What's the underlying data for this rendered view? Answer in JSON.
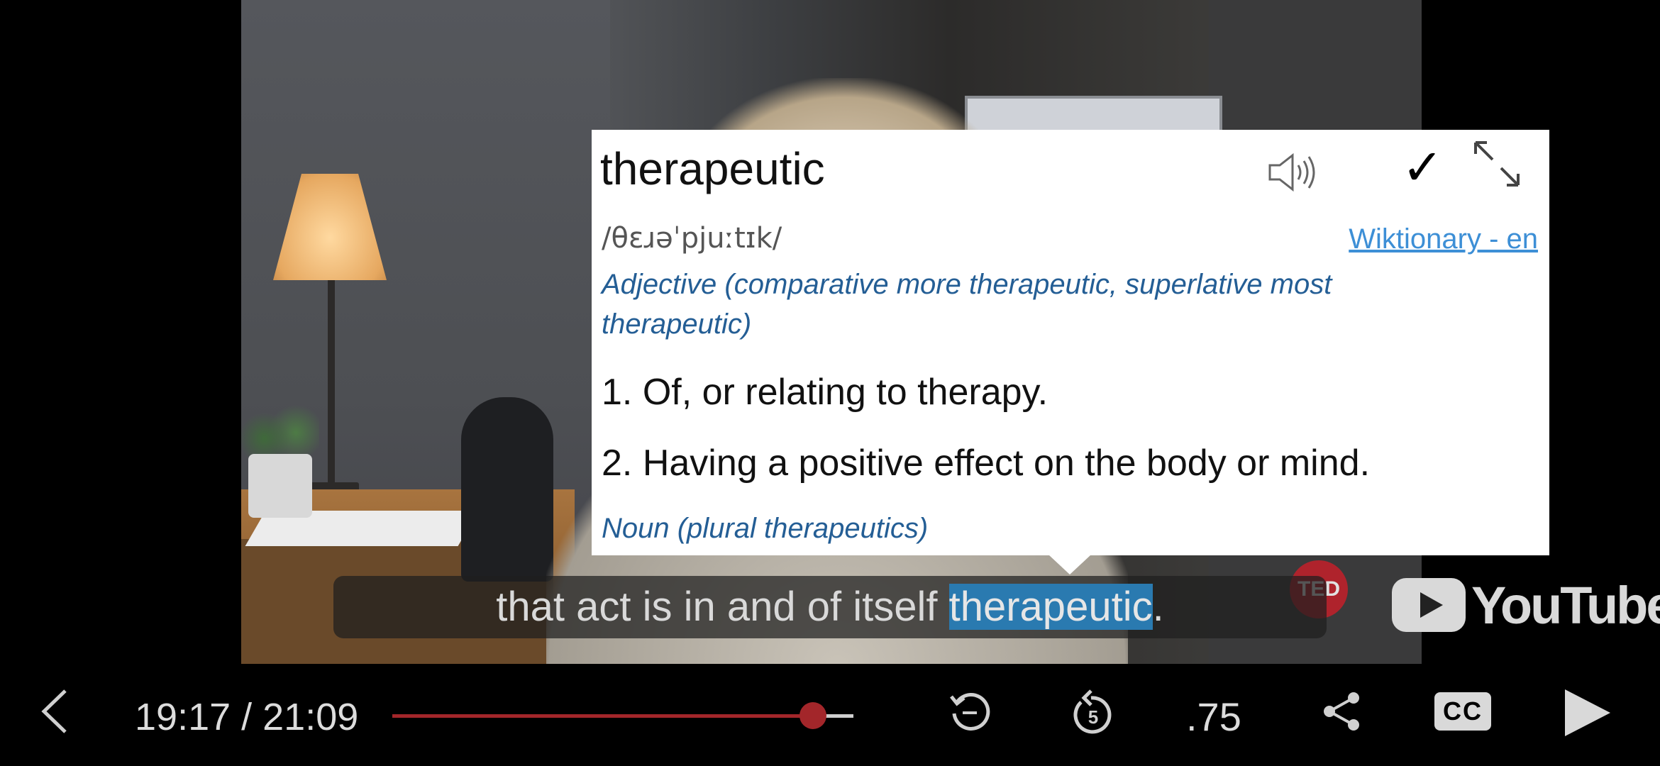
{
  "popup": {
    "word": "therapeutic",
    "pronunciation": "/θɛɹəˈpjuːtɪk/",
    "source_link": "Wiktionary - en",
    "part_of_speech_1": "Adjective (comparative more therapeutic, superlative most therapeutic)",
    "definition_1": "1. Of, or relating to therapy.",
    "definition_2": "2. Having a positive effect on the body or mind.",
    "part_of_speech_2": "Noun (plural therapeutics)",
    "icons": [
      "speaker-icon",
      "check-icon",
      "expand-icon"
    ]
  },
  "subtitle": {
    "before": "that act is in and of itself ",
    "highlighted": "therapeutic",
    "after": "."
  },
  "overlay": {
    "ted_badge": "TED",
    "youtube_logo": "YouTube"
  },
  "player": {
    "time": "19:17 / 21:09",
    "progress": 0.912,
    "speed": ".75",
    "cc_label": "CC",
    "icons": [
      "back-icon",
      "replay-icon",
      "rewind-5-icon",
      "share-icon",
      "cc-icon",
      "play-icon"
    ]
  },
  "colors": {
    "highlight": "#2a7ab0",
    "progress": "#a3262a",
    "link": "#3d8fd6",
    "pos_text": "#245e95"
  }
}
